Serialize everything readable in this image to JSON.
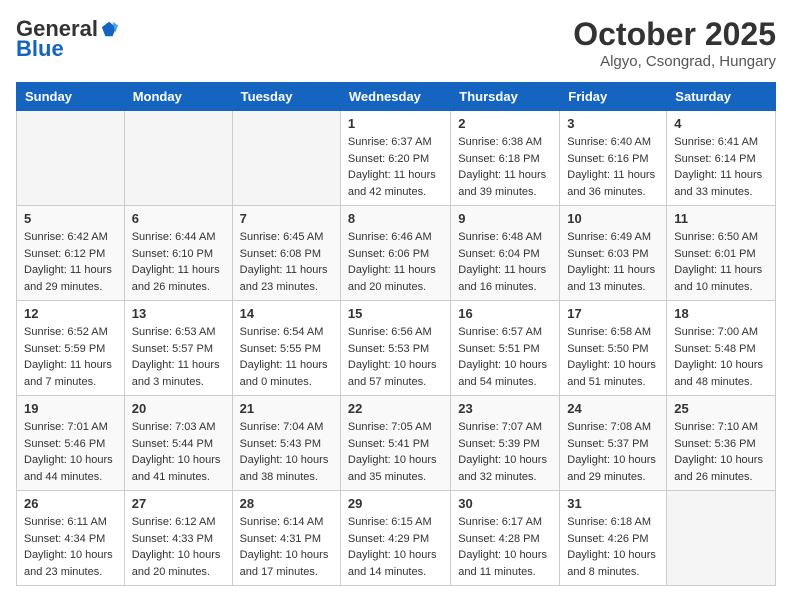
{
  "header": {
    "logo_general": "General",
    "logo_blue": "Blue",
    "month_title": "October 2025",
    "location": "Algyo, Csongrad, Hungary"
  },
  "days_of_week": [
    "Sunday",
    "Monday",
    "Tuesday",
    "Wednesday",
    "Thursday",
    "Friday",
    "Saturday"
  ],
  "weeks": [
    [
      {
        "day": "",
        "info": ""
      },
      {
        "day": "",
        "info": ""
      },
      {
        "day": "",
        "info": ""
      },
      {
        "day": "1",
        "info": "Sunrise: 6:37 AM\nSunset: 6:20 PM\nDaylight: 11 hours\nand 42 minutes."
      },
      {
        "day": "2",
        "info": "Sunrise: 6:38 AM\nSunset: 6:18 PM\nDaylight: 11 hours\nand 39 minutes."
      },
      {
        "day": "3",
        "info": "Sunrise: 6:40 AM\nSunset: 6:16 PM\nDaylight: 11 hours\nand 36 minutes."
      },
      {
        "day": "4",
        "info": "Sunrise: 6:41 AM\nSunset: 6:14 PM\nDaylight: 11 hours\nand 33 minutes."
      }
    ],
    [
      {
        "day": "5",
        "info": "Sunrise: 6:42 AM\nSunset: 6:12 PM\nDaylight: 11 hours\nand 29 minutes."
      },
      {
        "day": "6",
        "info": "Sunrise: 6:44 AM\nSunset: 6:10 PM\nDaylight: 11 hours\nand 26 minutes."
      },
      {
        "day": "7",
        "info": "Sunrise: 6:45 AM\nSunset: 6:08 PM\nDaylight: 11 hours\nand 23 minutes."
      },
      {
        "day": "8",
        "info": "Sunrise: 6:46 AM\nSunset: 6:06 PM\nDaylight: 11 hours\nand 20 minutes."
      },
      {
        "day": "9",
        "info": "Sunrise: 6:48 AM\nSunset: 6:04 PM\nDaylight: 11 hours\nand 16 minutes."
      },
      {
        "day": "10",
        "info": "Sunrise: 6:49 AM\nSunset: 6:03 PM\nDaylight: 11 hours\nand 13 minutes."
      },
      {
        "day": "11",
        "info": "Sunrise: 6:50 AM\nSunset: 6:01 PM\nDaylight: 11 hours\nand 10 minutes."
      }
    ],
    [
      {
        "day": "12",
        "info": "Sunrise: 6:52 AM\nSunset: 5:59 PM\nDaylight: 11 hours\nand 7 minutes."
      },
      {
        "day": "13",
        "info": "Sunrise: 6:53 AM\nSunset: 5:57 PM\nDaylight: 11 hours\nand 3 minutes."
      },
      {
        "day": "14",
        "info": "Sunrise: 6:54 AM\nSunset: 5:55 PM\nDaylight: 11 hours\nand 0 minutes."
      },
      {
        "day": "15",
        "info": "Sunrise: 6:56 AM\nSunset: 5:53 PM\nDaylight: 10 hours\nand 57 minutes."
      },
      {
        "day": "16",
        "info": "Sunrise: 6:57 AM\nSunset: 5:51 PM\nDaylight: 10 hours\nand 54 minutes."
      },
      {
        "day": "17",
        "info": "Sunrise: 6:58 AM\nSunset: 5:50 PM\nDaylight: 10 hours\nand 51 minutes."
      },
      {
        "day": "18",
        "info": "Sunrise: 7:00 AM\nSunset: 5:48 PM\nDaylight: 10 hours\nand 48 minutes."
      }
    ],
    [
      {
        "day": "19",
        "info": "Sunrise: 7:01 AM\nSunset: 5:46 PM\nDaylight: 10 hours\nand 44 minutes."
      },
      {
        "day": "20",
        "info": "Sunrise: 7:03 AM\nSunset: 5:44 PM\nDaylight: 10 hours\nand 41 minutes."
      },
      {
        "day": "21",
        "info": "Sunrise: 7:04 AM\nSunset: 5:43 PM\nDaylight: 10 hours\nand 38 minutes."
      },
      {
        "day": "22",
        "info": "Sunrise: 7:05 AM\nSunset: 5:41 PM\nDaylight: 10 hours\nand 35 minutes."
      },
      {
        "day": "23",
        "info": "Sunrise: 7:07 AM\nSunset: 5:39 PM\nDaylight: 10 hours\nand 32 minutes."
      },
      {
        "day": "24",
        "info": "Sunrise: 7:08 AM\nSunset: 5:37 PM\nDaylight: 10 hours\nand 29 minutes."
      },
      {
        "day": "25",
        "info": "Sunrise: 7:10 AM\nSunset: 5:36 PM\nDaylight: 10 hours\nand 26 minutes."
      }
    ],
    [
      {
        "day": "26",
        "info": "Sunrise: 6:11 AM\nSunset: 4:34 PM\nDaylight: 10 hours\nand 23 minutes."
      },
      {
        "day": "27",
        "info": "Sunrise: 6:12 AM\nSunset: 4:33 PM\nDaylight: 10 hours\nand 20 minutes."
      },
      {
        "day": "28",
        "info": "Sunrise: 6:14 AM\nSunset: 4:31 PM\nDaylight: 10 hours\nand 17 minutes."
      },
      {
        "day": "29",
        "info": "Sunrise: 6:15 AM\nSunset: 4:29 PM\nDaylight: 10 hours\nand 14 minutes."
      },
      {
        "day": "30",
        "info": "Sunrise: 6:17 AM\nSunset: 4:28 PM\nDaylight: 10 hours\nand 11 minutes."
      },
      {
        "day": "31",
        "info": "Sunrise: 6:18 AM\nSunset: 4:26 PM\nDaylight: 10 hours\nand 8 minutes."
      },
      {
        "day": "",
        "info": ""
      }
    ]
  ]
}
